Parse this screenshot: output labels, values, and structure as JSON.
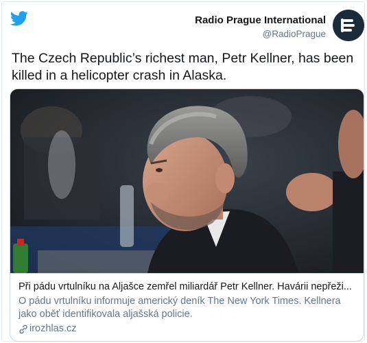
{
  "tweet": {
    "author": {
      "display_name": "Radio Prague International",
      "handle": "@RadioPrague",
      "avatar_icon": "radio-prague-logo-icon",
      "avatar_color": "#1a2c3a"
    },
    "platform_icon": "twitter-bird-icon",
    "brand_color": "#1da1f2",
    "text": "The Czech Republic’s richest man, Petr Kellner, has been killed in a helicopter crash in Alaska.",
    "link_card": {
      "image_description": "photo of a grey-haired man in a suit at a conference",
      "title": "Při pádu vrtulníku na Aljašce zemřel miliardář Petr Kellner. Havárii nepřeži...",
      "description": "O pádu vrtulníku informuje americký deník The New York Times. Kellnera jako oběť identifikovala aljašská policie.",
      "domain": "irozhlas.cz",
      "domain_icon": "link-icon"
    }
  }
}
